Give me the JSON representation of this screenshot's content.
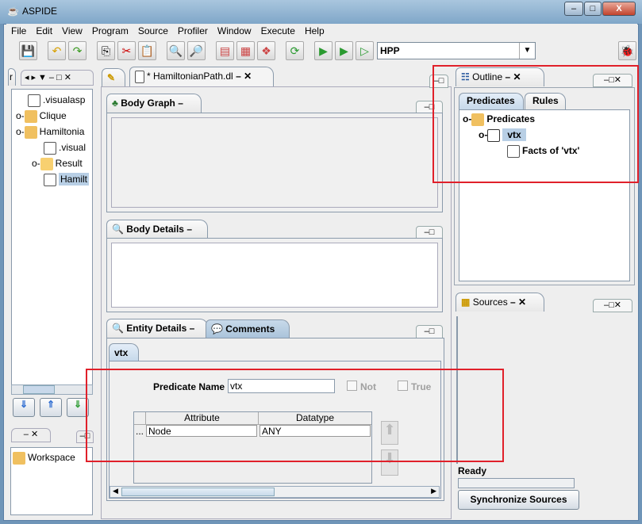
{
  "window": {
    "title": "ASPIDE",
    "min": "–",
    "max": "□",
    "close": "X"
  },
  "menu": [
    "File",
    "Edit",
    "View",
    "Program",
    "Source",
    "Profiler",
    "Window",
    "Execute",
    "Help"
  ],
  "toolbar": {
    "run_config": "HPP"
  },
  "explorer": {
    "tab_fragment": "r",
    "items": [
      ".visualasp",
      "Clique",
      "Hamiltonia",
      ".visual",
      "Result",
      "Hamilt"
    ]
  },
  "workspace": {
    "item": "Workspace"
  },
  "editor": {
    "tab": "* HamiltonianPath.dl"
  },
  "body_graph": {
    "title": "Body Graph"
  },
  "body_details": {
    "title": "Body Details"
  },
  "entity": {
    "tabs": [
      "Entity Details",
      "Comments"
    ],
    "subtab": "vtx",
    "predicate_label": "Predicate Name",
    "predicate_value": "vtx",
    "not_label": "Not",
    "true_label": "True",
    "columns": [
      "Attribute",
      "Datatype"
    ],
    "rows": [
      {
        "marker": "...",
        "attribute": "Node",
        "datatype": "ANY"
      }
    ]
  },
  "outline": {
    "title": "Outline",
    "tabs": [
      "Predicates",
      "Rules"
    ],
    "tree": [
      "Predicates",
      "vtx",
      "Facts of 'vtx'"
    ]
  },
  "sources": {
    "title": "Sources"
  },
  "status": {
    "text": "Ready",
    "sync_button": "Synchronize Sources"
  },
  "colors": {
    "highlight": "#e0202a",
    "selection": "#b8cfe5"
  }
}
